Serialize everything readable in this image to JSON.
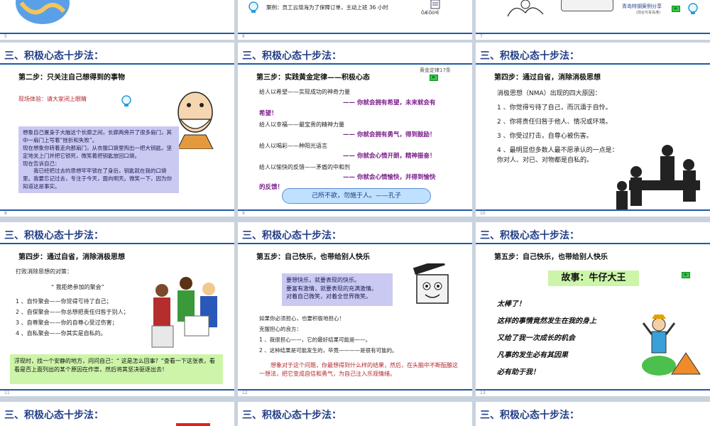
{
  "slides": {
    "s5": {
      "num": "5"
    },
    "s6": {
      "num": "6",
      "case_text": "案例：员工云增海为了保障订单，主动上班 36 小时",
      "doc_label": "ÔÆÔöºÉ"
    },
    "s7": {
      "num": "7",
      "share_title": "青岛特钢案例分享",
      "share_sub": "(前台与青岛港)"
    },
    "s8": {
      "num": "8",
      "title": "三、积极心态十步法：",
      "step": "第二步：只关注自己想得到的事物",
      "experience": "现场体验：请大家闭上眼睛",
      "box": [
        "想象自己置身于大脑这个长廊之间，长廊两旁开了很多扇门，其中一扇门上写着“挫折和失败”。",
        "现在想象你转着走向那扇门，从衣服口袋里掏出一把大钥匙，坚定地关上门并把它锁死，微笑着把钥匙放回口袋。",
        "现在告诉自己：",
        "我已经把过去的思想牢牢锁在了身后，钥匙就在我的口袋里。我要忘记过去，专注于今天，面向明天。微笑一下，因为你知道这是事实。"
      ]
    },
    "s9": {
      "num": "9",
      "title": "三、积极心态十步法：",
      "step": "第三步：实践黄金定律——积极心态",
      "ref": "黄金定律17条",
      "lines": [
        {
          "a": "给人以希望——实现成功的神奇力量",
          "b": "—— 你就会拥有希望，未来就会有",
          "c": "希望！"
        },
        {
          "a": "给人以幸福——最宝贵的精神力量",
          "b": "—— 你就会拥有勇气，得到鼓励！"
        },
        {
          "a": "给人以喝彩——种阳光语言",
          "b": "—— 你就会心情开朗，精神振奋！"
        },
        {
          "a": "给人以愉快的反馈——矛盾的中和剂",
          "b": "—— 你就会心情愉快，并得到愉快",
          "c": "的反馈！"
        }
      ],
      "quote": "己所不欲，勿施于人。——孔子"
    },
    "s10": {
      "num": "10",
      "title": "三、积极心态十步法：",
      "step": "第四步：通过自省，消除消极思想",
      "intro": "消极思想（NMA）出现的四大原因：",
      "items": [
        "1 、你觉得亏待了自己，而沉湎于自怜。",
        "2 、你将责任归咎于他人、情况或环境。",
        "3 、你受过打击，自尊心被伤害。",
        "4 、最明显但多数人最不愿承认的一点是：",
        "你对人、对已、对物都是自私的。"
      ]
    },
    "s11": {
      "num": "11",
      "title": "三、积极心态十步法：",
      "step": "第四步：通过自省，消除消极思想",
      "intro": "打败消除思想的对策：",
      "party": "“ 我拒绝参加的聚会”",
      "items": [
        "1 、自怜聚会——你觉得亏待了自己；",
        "2 、自保聚会——你总想把责任归咎于别人；",
        "3 、自尊聚会——你的自尊心受过伤害；",
        "4 、自私聚会——你其实是自私的。"
      ],
      "box": "浮现时，找一个安静的地方，问问自己：“ 这是怎么回事？”查看一下这张表，看看是否上面列出的某个原因在作祟，然后将其坚决驱逐出去！"
    },
    "s12": {
      "num": "12",
      "title": "三、积极心态十步法：",
      "step": "第五步：自己快乐，也带给别人快乐",
      "box": [
        "要想快乐，就要表现的快乐。",
        "要富有激情，就要表现的充满激情。",
        "对着自己微笑，对着全世界微笑。"
      ],
      "worry": [
        "如果你必须担心，也要积极地担心！",
        "克服担心的良方：",
        "1 、我很担心——，它的最好结果可能是——。",
        "2 、这种结果是可能发生的，毕竟————是很有可能的。"
      ],
      "advice": "想象对于这个问题，你最想得到什么样的结果，然后，在头脑中不断酝酿这一想法，把它变成自信和勇气，为自己注入乐观情绪。"
    },
    "s13": {
      "num": "13",
      "title": "三、积极心态十步法：",
      "step": "第五步：自己快乐，也带给别人快乐",
      "story": "故事：牛仔大王",
      "hand": [
        "太棒了！",
        "这样的事情竟然发生在我的身上",
        "又给了我一次成长的机会",
        "凡事的发生必有其因果",
        "必有助于我！"
      ]
    },
    "s14": {
      "title": "三、积极心态十步法："
    },
    "s15": {
      "title": "三、积极心态十步法："
    },
    "s16": {
      "title": "三、积极心态十步法："
    }
  }
}
